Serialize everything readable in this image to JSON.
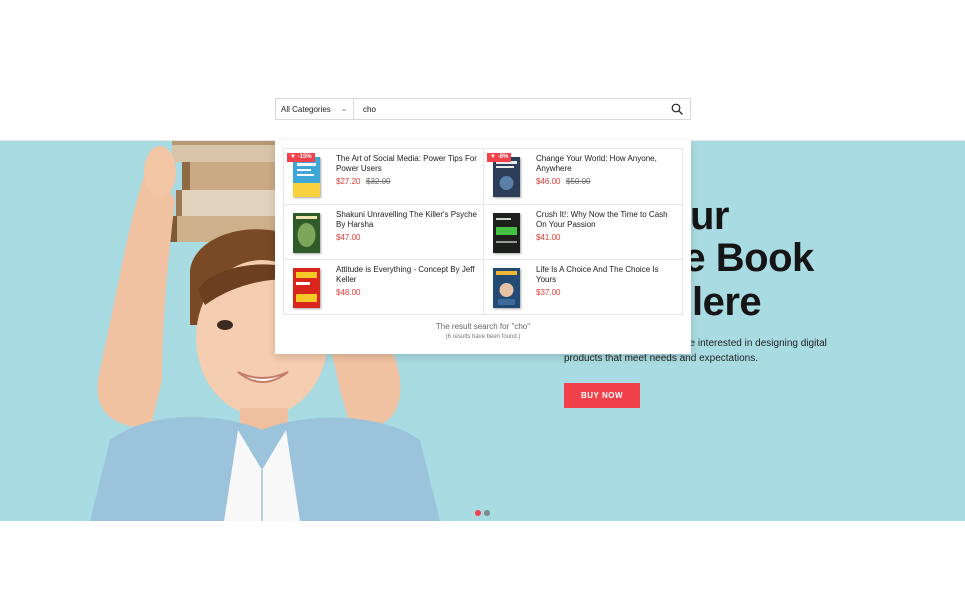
{
  "search": {
    "category": "All Categories",
    "query": "cho"
  },
  "results": {
    "items": [
      {
        "title": "The Art of Social Media: Power Tips For Power Users",
        "price": "$27.20",
        "old_price": "$32.00",
        "badge": "-15%"
      },
      {
        "title": "Change Your World: How Anyone, Anywhere",
        "price": "$46.00",
        "old_price": "$50.00",
        "badge": "-8%"
      },
      {
        "title": "Shakuni Unravelling The Killer's Psyche By Harsha",
        "price": "$47.00"
      },
      {
        "title": "Crush It!: Why Now the Time to Cash On Your Passion",
        "price": "$41.00"
      },
      {
        "title": "Attitude is Everything - Concept By Jeff Keller",
        "price": "$48.00"
      },
      {
        "title": "Life Is A Choice And The Choice Is Yours",
        "price": "$37.00"
      }
    ],
    "summary": "The result search for \"cho\"",
    "count_text": "(6 results have been found.)"
  },
  "hero": {
    "title_line_1": "ur",
    "title_line_2": "ite Book",
    "title_line_3": "lere",
    "description_line_1": "ne interested in designing digital",
    "description_line_2": "products that meet needs and expectations.",
    "button_label": "BUY NOW",
    "slides_total": 2,
    "active_slide": 1
  },
  "colors": {
    "accent": "#f2414b",
    "hero_bg": "#a9dbe2",
    "price": "#e53935"
  },
  "icons": {
    "search": "search-icon",
    "chevron": "chevron-down-icon",
    "badge": "discount-tag-icon"
  }
}
